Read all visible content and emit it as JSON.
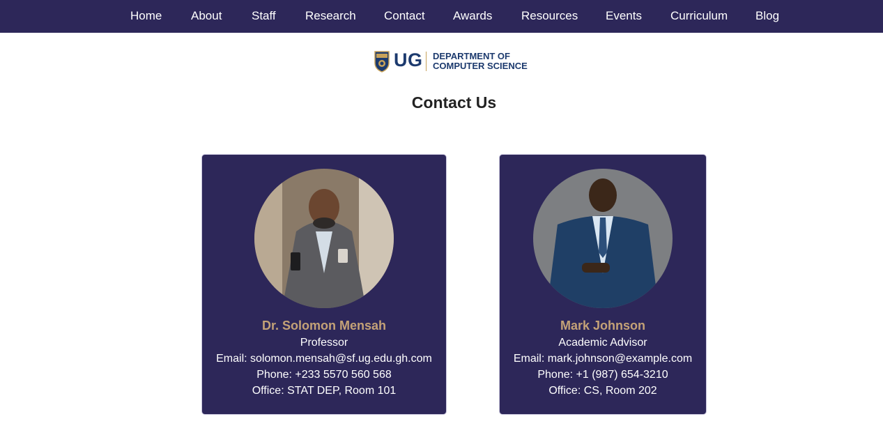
{
  "nav": {
    "items": [
      {
        "label": "Home"
      },
      {
        "label": "About"
      },
      {
        "label": "Staff"
      },
      {
        "label": "Research"
      },
      {
        "label": "Contact"
      },
      {
        "label": "Awards"
      },
      {
        "label": "Resources"
      },
      {
        "label": "Events"
      },
      {
        "label": "Curriculum"
      },
      {
        "label": "Blog"
      }
    ]
  },
  "logo": {
    "abbr": "UG",
    "line1": "DEPARTMENT OF",
    "line2": "COMPUTER SCIENCE",
    "icon": "crest-icon"
  },
  "page": {
    "title": "Contact Us"
  },
  "contacts": [
    {
      "name": "Dr. Solomon Mensah",
      "role": "Professor",
      "email": "Email: solomon.mensah@sf.ug.edu.gh.com",
      "phone": "Phone: +233 5570 560 568",
      "office": "Office: STAT DEP, Room 101"
    },
    {
      "name": "Mark Johnson",
      "role": "Academic Advisor",
      "email": "Email: mark.johnson@example.com",
      "phone": "Phone: +1 (987) 654-3210",
      "office": "Office: CS, Room 202"
    }
  ],
  "colors": {
    "nav_bg": "#2d2759",
    "card_bg": "#2d2759",
    "name_accent": "#c4a277",
    "logo_blue": "#1c3a6e"
  }
}
